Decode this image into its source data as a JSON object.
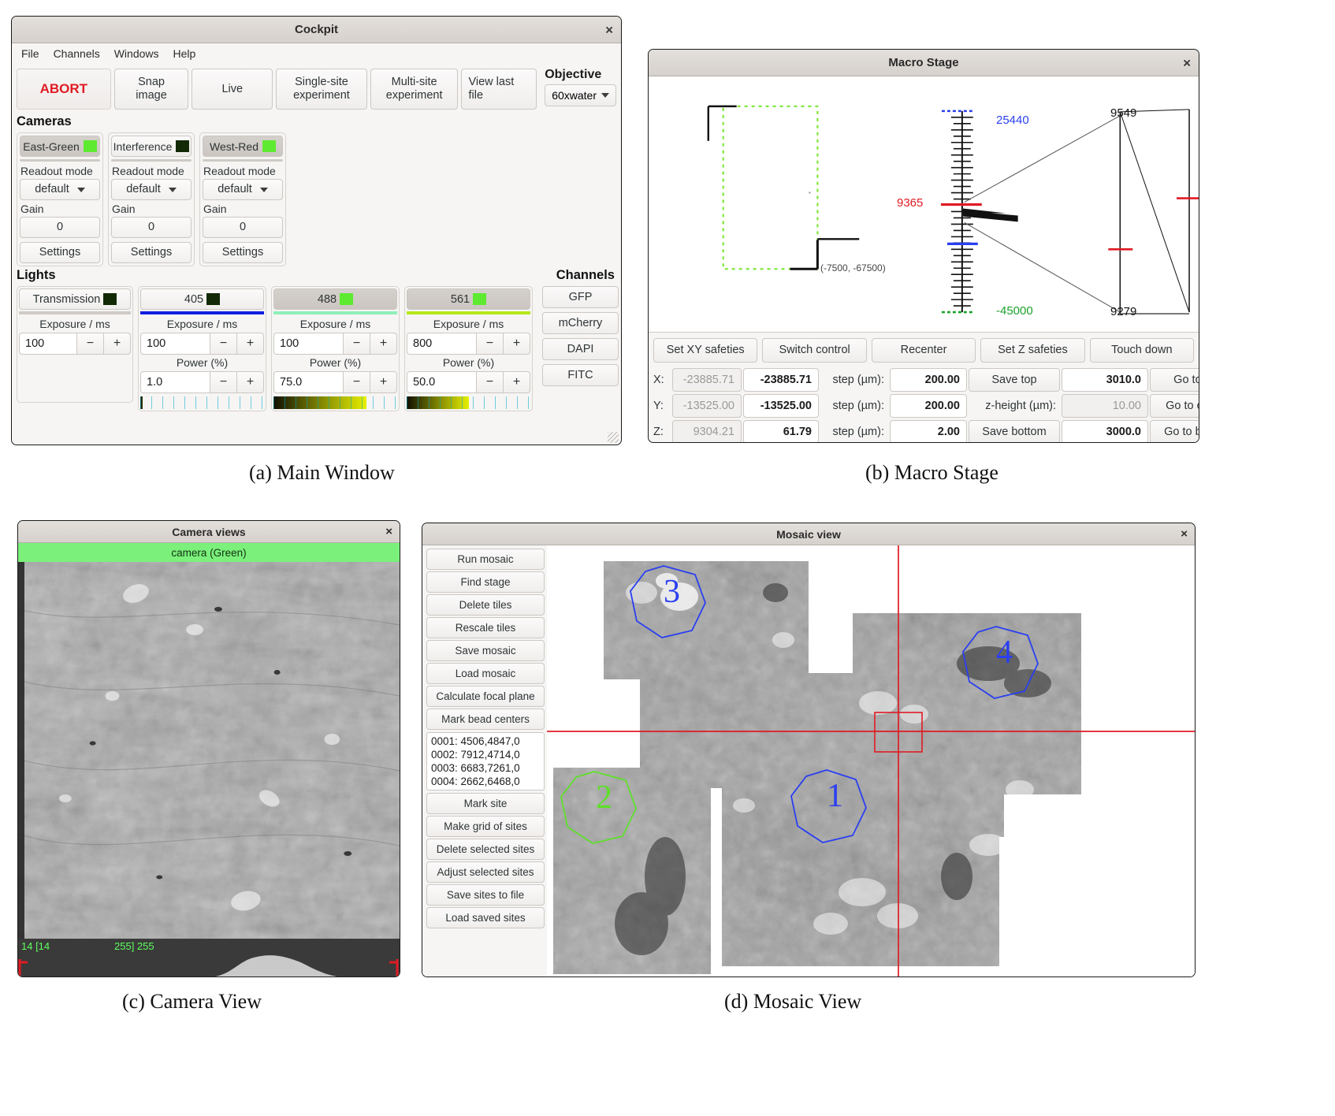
{
  "main_window": {
    "title": "Cockpit",
    "close_icon": "close-icon",
    "menu": [
      "File",
      "Channels",
      "Windows",
      "Help"
    ],
    "toolbar": {
      "abort": "ABORT",
      "snap_image": "Snap\nimage",
      "snap_image_line1": "Snap",
      "snap_image_line2": "image",
      "live": "Live",
      "single_site_line1": "Single-site",
      "single_site_line2": "experiment",
      "multi_site_line1": "Multi-site",
      "multi_site_line2": "experiment",
      "view_last_line1": "View last",
      "view_last_line2": "file"
    },
    "objective": {
      "title": "Objective",
      "value": "60xwater"
    },
    "cameras_title": "Cameras",
    "cameras": [
      {
        "name": "East-Green",
        "enabled": true,
        "indicator_color": "#5eea31",
        "readout_label": "Readout mode",
        "readout_value": "default",
        "gain_label": "Gain",
        "gain_value": "0",
        "settings_label": "Settings"
      },
      {
        "name": "Interference",
        "enabled": false,
        "indicator_color": "#132a06",
        "readout_label": "Readout mode",
        "readout_value": "default",
        "gain_label": "Gain",
        "gain_value": "0",
        "settings_label": "Settings"
      },
      {
        "name": "West-Red",
        "enabled": true,
        "indicator_color": "#5eea31",
        "readout_label": "Readout mode",
        "readout_value": "default",
        "gain_label": "Gain",
        "gain_value": "0",
        "settings_label": "Settings"
      }
    ],
    "lights_title": "Lights",
    "lights": [
      {
        "name": "Transmission",
        "enabled": false,
        "indicator_color": "#132a06",
        "bar_color": "#cfcac5",
        "exposure_label": "Exposure / ms",
        "exposure_value": "100",
        "power_label": null,
        "power_value": null,
        "slider_color": null
      },
      {
        "name": "405",
        "enabled": false,
        "indicator_color": "#132a06",
        "bar_color": "#0f1fe0",
        "exposure_label": "Exposure / ms",
        "exposure_value": "100",
        "power_label": "Power (%)",
        "power_value": "1.0",
        "slider_color": "#1a1a08",
        "slider_fill": 2
      },
      {
        "name": "488",
        "enabled": true,
        "indicator_color": "#5eea31",
        "bar_color": "#8ef0b8",
        "exposure_label": "Exposure / ms",
        "exposure_value": "100",
        "power_label": "Power (%)",
        "power_value": "75.0",
        "slider_color": "#dfe800",
        "slider_fill": 75
      },
      {
        "name": "561",
        "enabled": true,
        "indicator_color": "#5eea31",
        "bar_color": "#b6e819",
        "exposure_label": "Exposure / ms",
        "exposure_value": "800",
        "power_label": "Power (%)",
        "power_value": "50.0",
        "slider_color": "#dfe800",
        "slider_fill": 50
      }
    ],
    "minus": "−",
    "plus": "+",
    "channels_title": "Channels",
    "channels": [
      "GFP",
      "mCherry",
      "DAPI",
      "FITC"
    ]
  },
  "macro_stage": {
    "title": "Macro Stage",
    "close_icon": "close-icon",
    "canvas": {
      "safety_box_label": "(-7500, -67500)",
      "z_top_label": "25440",
      "z_bottom_label": "-45000",
      "z_current_label": "9365",
      "right_top_label": "9549",
      "right_bottom_label": "9279",
      "top_color": "#2a3ff0",
      "bottom_color": "#1aa22a",
      "current_color": "#e01b24",
      "box_color": "#7ee83c"
    },
    "buttons": [
      "Set XY safeties",
      "Switch control",
      "Recenter",
      "Set Z safeties",
      "Touch down"
    ],
    "rows": [
      {
        "axis": "X:",
        "readonly_value": "-23885.71",
        "value": "-23885.71",
        "step_label": "step (µm):",
        "step_value": "200.00",
        "action_label": "Save top",
        "action_is_button": true,
        "extra_value": "3010.0",
        "extra_readonly": false,
        "go_label": "Go to top"
      },
      {
        "axis": "Y:",
        "readonly_value": "-13525.00",
        "value": "-13525.00",
        "step_label": "step (µm):",
        "step_value": "200.00",
        "action_label": "z-height (µm):",
        "action_is_button": false,
        "extra_value": "10.00",
        "extra_readonly": true,
        "go_label": "Go to centre"
      },
      {
        "axis": "Z:",
        "readonly_value": "9304.21",
        "value": "61.79",
        "step_label": "step (µm):",
        "step_value": "2.00",
        "action_label": "Save bottom",
        "action_is_button": true,
        "extra_value": "3000.0",
        "extra_readonly": false,
        "go_label": "Go to bottom"
      }
    ]
  },
  "camera_view": {
    "title": "Camera views",
    "close_icon": "close-icon",
    "banner": "camera (Green)",
    "banner_color": "#7bf07b",
    "histogram": {
      "left_text": "14 [14",
      "right_text": "255] 255",
      "text_color": "#5dff5d"
    }
  },
  "mosaic_view": {
    "title": "Mosaic view",
    "close_icon": "close-icon",
    "buttons_top": [
      "Run mosaic",
      "Find stage",
      "Delete tiles",
      "Rescale tiles",
      "Save mosaic",
      "Load mosaic",
      "Calculate focal plane",
      "Mark bead centers"
    ],
    "sites": [
      "0001: 4506,4847,0",
      "0002: 7912,4714,0",
      "0003: 6683,7261,0",
      "0004: 2662,6468,0"
    ],
    "buttons_bottom": [
      "Mark site",
      "Make grid of sites",
      "Delete selected sites",
      "Adjust selected sites",
      "Save sites to file",
      "Load saved sites"
    ],
    "site_markers": [
      {
        "label": "1",
        "color": "#2a3ff0"
      },
      {
        "label": "2",
        "color": "#5ee02a"
      },
      {
        "label": "3",
        "color": "#2a3ff0"
      },
      {
        "label": "4",
        "color": "#2a3ff0"
      }
    ],
    "crosshair_color": "#e01b24"
  },
  "captions": {
    "a": "(a)  Main Window",
    "b": "(b)  Macro Stage",
    "c": "(c)  Camera View",
    "d": "(d)  Mosaic View"
  }
}
